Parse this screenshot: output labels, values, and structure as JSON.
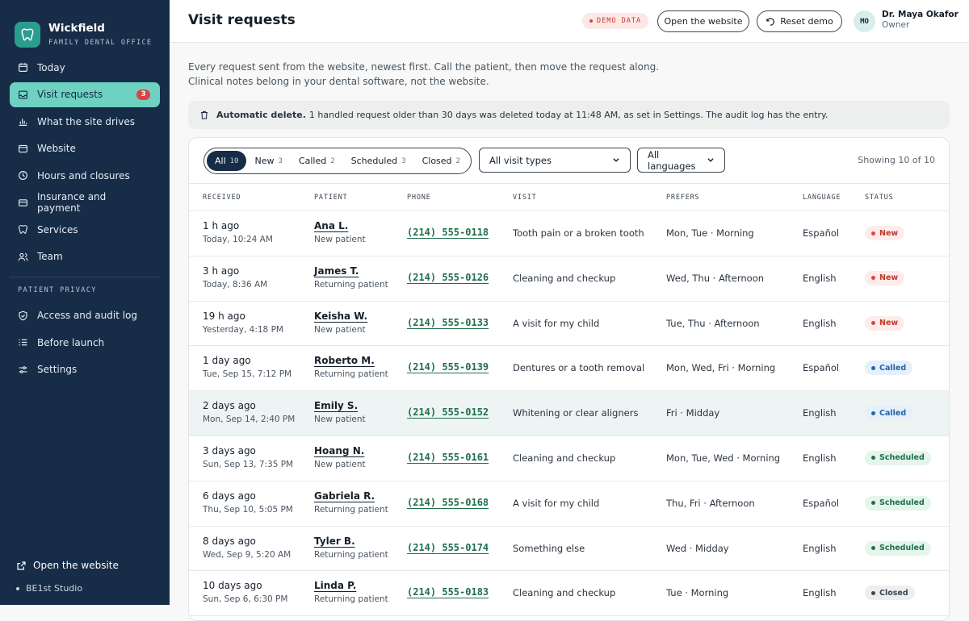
{
  "brand": {
    "name": "Wickfield",
    "subtitle": "FAMILY DENTAL OFFICE"
  },
  "sidebar": {
    "items": [
      {
        "label": "Today",
        "icon": "calendar-icon"
      },
      {
        "label": "Visit requests",
        "icon": "inbox-icon",
        "badge": "3",
        "active": true
      },
      {
        "label": "What the site drives",
        "icon": "bar-chart-icon"
      },
      {
        "label": "Website",
        "icon": "browser-icon"
      },
      {
        "label": "Hours and closures",
        "icon": "clock-icon"
      },
      {
        "label": "Insurance and payment",
        "icon": "credit-card-icon"
      },
      {
        "label": "Services",
        "icon": "tooth-icon"
      },
      {
        "label": "Team",
        "icon": "users-icon"
      }
    ],
    "privacy_section": "PATIENT PRIVACY",
    "privacy_items": [
      {
        "label": "Access and audit log",
        "icon": "shield-icon"
      },
      {
        "label": "Before launch",
        "icon": "checklist-icon"
      },
      {
        "label": "Settings",
        "icon": "sliders-icon"
      }
    ],
    "open_website": "Open the website",
    "studio": "BE1st Studio"
  },
  "header": {
    "title": "Visit requests",
    "demo_badge": "DEMO DATA",
    "open_button": "Open the website",
    "reset_button": "Reset demo",
    "avatar_initials": "MO",
    "user_name": "Dr. Maya Okafor",
    "user_role": "Owner"
  },
  "intro": {
    "line1": "Every request sent from the website, newest first. Call the patient, then move the request along.",
    "line2": "Clinical notes belong in your dental software, not the website."
  },
  "notice": {
    "bold": "Automatic delete.",
    "text": "1 handled request older than 30 days was deleted today at 11:48 AM, as set in Settings. The audit log has the entry."
  },
  "filters": {
    "segments": [
      {
        "label": "All",
        "count": "10",
        "active": true
      },
      {
        "label": "New",
        "count": "3"
      },
      {
        "label": "Called",
        "count": "2"
      },
      {
        "label": "Scheduled",
        "count": "3"
      },
      {
        "label": "Closed",
        "count": "2"
      }
    ],
    "visit_type": "All visit types",
    "language": "All languages",
    "showing": "Showing 10 of 10"
  },
  "table": {
    "columns": [
      "RECEIVED",
      "PATIENT",
      "PHONE",
      "VISIT",
      "PREFERS",
      "LANGUAGE",
      "STATUS"
    ],
    "rows": [
      {
        "ago": "1 h ago",
        "when": "Today, 10:24 AM",
        "patient": "Ana L.",
        "type": "New patient",
        "phone": "(214) 555-0118",
        "visit": "Tooth pain or a broken tooth",
        "prefers": "Mon, Tue · Morning",
        "language": "Español",
        "status": "New"
      },
      {
        "ago": "3 h ago",
        "when": "Today, 8:36 AM",
        "patient": "James T.",
        "type": "Returning patient",
        "phone": "(214) 555-0126",
        "visit": "Cleaning and checkup",
        "prefers": "Wed, Thu · Afternoon",
        "language": "English",
        "status": "New"
      },
      {
        "ago": "19 h ago",
        "when": "Yesterday, 4:18 PM",
        "patient": "Keisha W.",
        "type": "New patient",
        "phone": "(214) 555-0133",
        "visit": "A visit for my child",
        "prefers": "Tue, Thu · Afternoon",
        "language": "English",
        "status": "New"
      },
      {
        "ago": "1 day ago",
        "when": "Tue, Sep 15, 7:12 PM",
        "patient": "Roberto M.",
        "type": "Returning patient",
        "phone": "(214) 555-0139",
        "visit": "Dentures or a tooth removal",
        "prefers": "Mon, Wed, Fri · Morning",
        "language": "Español",
        "status": "Called"
      },
      {
        "ago": "2 days ago",
        "when": "Mon, Sep 14, 2:40 PM",
        "patient": "Emily S.",
        "type": "New patient",
        "phone": "(214) 555-0152",
        "visit": "Whitening or clear aligners",
        "prefers": "Fri · Midday",
        "language": "English",
        "status": "Called"
      },
      {
        "ago": "3 days ago",
        "when": "Sun, Sep 13, 7:35 PM",
        "patient": "Hoang N.",
        "type": "New patient",
        "phone": "(214) 555-0161",
        "visit": "Cleaning and checkup",
        "prefers": "Mon, Tue, Wed · Morning",
        "language": "English",
        "status": "Scheduled"
      },
      {
        "ago": "6 days ago",
        "when": "Thu, Sep 10, 5:05 PM",
        "patient": "Gabriela R.",
        "type": "Returning patient",
        "phone": "(214) 555-0168",
        "visit": "A visit for my child",
        "prefers": "Thu, Fri · Afternoon",
        "language": "Español",
        "status": "Scheduled"
      },
      {
        "ago": "8 days ago",
        "when": "Wed, Sep 9, 5:20 AM",
        "patient": "Tyler B.",
        "type": "Returning patient",
        "phone": "(214) 555-0174",
        "visit": "Something else",
        "prefers": "Wed · Midday",
        "language": "English",
        "status": "Scheduled"
      },
      {
        "ago": "10 days ago",
        "when": "Sun, Sep 6, 6:30 PM",
        "patient": "Linda P.",
        "type": "Returning patient",
        "phone": "(214) 555-0183",
        "visit": "Cleaning and checkup",
        "prefers": "Tue · Morning",
        "language": "English",
        "status": "Closed"
      }
    ]
  },
  "colors": {
    "sidebar_bg": "#172c47",
    "accent": "#6fd1c2",
    "new": "#d64545",
    "called": "#2563a8",
    "scheduled": "#1f6f4c",
    "closed": "#3a4551"
  }
}
